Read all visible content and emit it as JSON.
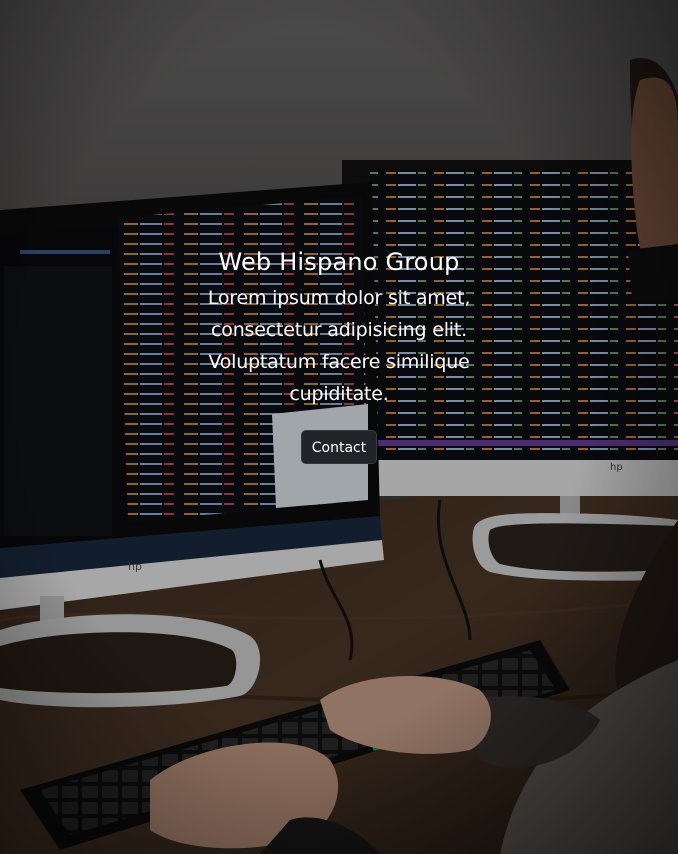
{
  "hero": {
    "title": "Web Hispano Group",
    "lead": "Lorem ipsum dolor sit amet, consectetur adipisicing elit. Voluptatum facere similique cupiditate.",
    "button_label": "Contact"
  }
}
